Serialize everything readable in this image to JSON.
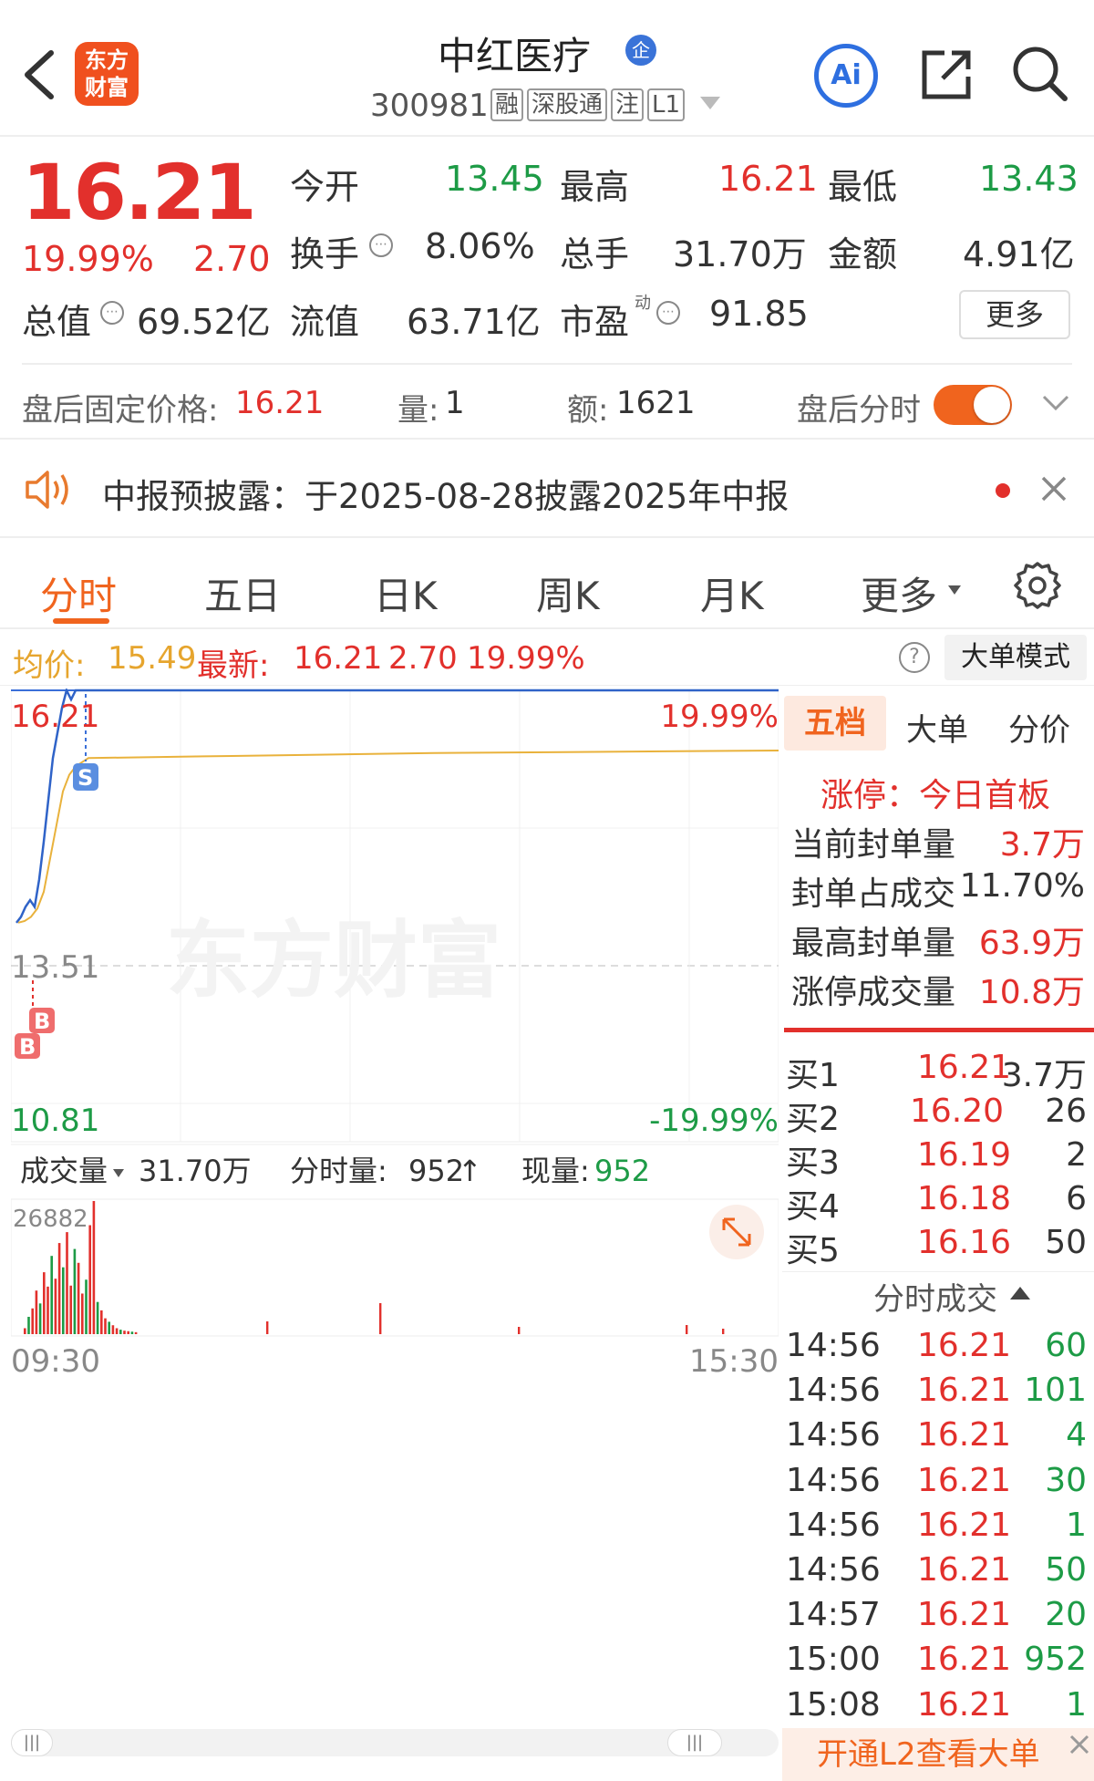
{
  "header": {
    "logo_line1": "东方",
    "logo_line2": "财富",
    "stock_name": "中红医疗",
    "enterprise_badge": "企",
    "stock_code": "300981",
    "tags": [
      "融",
      "深股通",
      "注",
      "L1"
    ],
    "ai_label": "Ai"
  },
  "quote": {
    "price": "16.21",
    "change_pct": "19.99%",
    "change_amt": "2.70",
    "fields": [
      {
        "label": "今开",
        "value": "13.45"
      },
      {
        "label": "最高",
        "value": "16.21"
      },
      {
        "label": "最低",
        "value": "13.43"
      },
      {
        "label": "换手",
        "value": "8.06%"
      },
      {
        "label": "总手",
        "value": "31.70万"
      },
      {
        "label": "金额",
        "value": "4.91亿"
      },
      {
        "label": "总值",
        "value": "69.52亿"
      },
      {
        "label": "流值",
        "value": "63.71亿"
      },
      {
        "label": "市盈",
        "value": "91.85"
      }
    ],
    "pe_sup": "动",
    "more_button": "更多"
  },
  "afterhours": {
    "fixed_price_label": "盘后固定价格:",
    "fixed_price": "16.21",
    "volume_label": "量:",
    "volume": "1",
    "amount_label": "额:",
    "amount": "1621",
    "toggle_label": "盘后分时"
  },
  "notice": {
    "text": "中报预披露：于2025-08-28披露2025年中报"
  },
  "tabs": [
    "分时",
    "五日",
    "日K",
    "周K",
    "月K",
    "更多"
  ],
  "info": {
    "avg_label": "均价:",
    "avg_value": "15.49",
    "latest_label": "最新:",
    "latest_value": "16.21",
    "change": "2.70",
    "pct": "19.99%",
    "mode_button": "大单模式"
  },
  "chart_data": {
    "type": "line",
    "price_high": "16.21",
    "price_mid": "13.51",
    "price_mid_shown": "13.51",
    "price_low": "10.81",
    "pct_high": "19.99%",
    "pct_low": "-19.99%",
    "x_start": "09:30",
    "x_end": "15:30",
    "markers": [
      "S",
      "B",
      "B"
    ],
    "watermark": "东方财富",
    "price_series": [
      13.43,
      13.5,
      13.62,
      13.7,
      13.62,
      13.95,
      14.4,
      14.9,
      15.4,
      15.7,
      16.0,
      16.21,
      16.1,
      16.21,
      16.21
    ],
    "avg_series": [
      13.43,
      13.45,
      13.5,
      13.6,
      13.8,
      14.2,
      14.6,
      15.0,
      15.2,
      15.3,
      15.35,
      15.4,
      15.42,
      15.44,
      15.46,
      15.47,
      15.48,
      15.49
    ],
    "volume_max": "26882",
    "volume_bars": [
      1200,
      3500,
      5200,
      8800,
      6200,
      12500,
      9600,
      15800,
      11200,
      18400,
      13500,
      20600,
      9800,
      17200,
      14400,
      8200,
      11000,
      22000,
      26882,
      6500,
      4800,
      3200,
      2500,
      1800,
      1200,
      900,
      700,
      600,
      500,
      400
    ]
  },
  "volume_bar": {
    "label": "成交量",
    "total": "31.70万",
    "minute_label": "分时量:",
    "minute_value": "952",
    "current_label": "现量:",
    "current_value": "952"
  },
  "side": {
    "tabs": [
      "五档",
      "大单",
      "分价"
    ],
    "limit_label": "涨停：今日首板",
    "stats": [
      {
        "label": "当前封单量",
        "value": "3.7万"
      },
      {
        "label": "封单占成交",
        "value": "11.70%"
      },
      {
        "label": "最高封单量",
        "value": "63.9万"
      },
      {
        "label": "涨停成交量",
        "value": "10.8万"
      }
    ],
    "bids": [
      {
        "label": "买1",
        "price": "16.21",
        "vol": "3.7万"
      },
      {
        "label": "买2",
        "price": "16.20",
        "vol": "26"
      },
      {
        "label": "买3",
        "price": "16.19",
        "vol": "2"
      },
      {
        "label": "买4",
        "price": "16.18",
        "vol": "6"
      },
      {
        "label": "买5",
        "price": "16.16",
        "vol": "50"
      }
    ],
    "trades_title": "分时成交",
    "trades": [
      {
        "t": "14:56",
        "p": "16.21",
        "v": "60"
      },
      {
        "t": "14:56",
        "p": "16.21",
        "v": "101"
      },
      {
        "t": "14:56",
        "p": "16.21",
        "v": "4"
      },
      {
        "t": "14:56",
        "p": "16.21",
        "v": "30"
      },
      {
        "t": "14:56",
        "p": "16.21",
        "v": "1"
      },
      {
        "t": "14:56",
        "p": "16.21",
        "v": "50"
      },
      {
        "t": "14:57",
        "p": "16.21",
        "v": "20"
      },
      {
        "t": "15:00",
        "p": "16.21",
        "v": "952"
      },
      {
        "t": "15:08",
        "p": "16.21",
        "v": "1"
      }
    ],
    "l2_banner": "开通L2查看大单"
  }
}
